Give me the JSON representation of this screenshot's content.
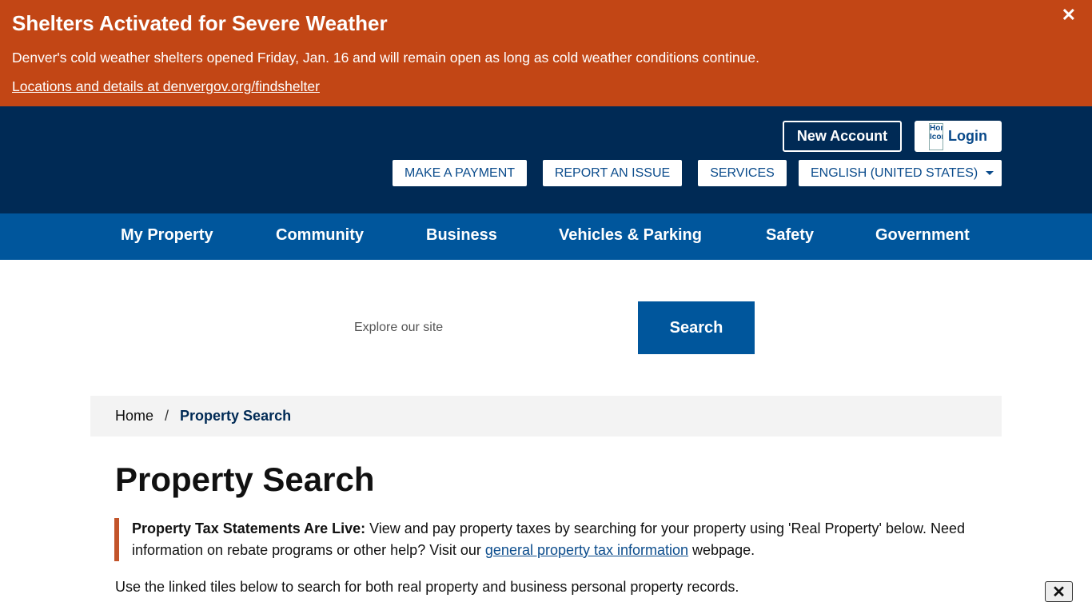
{
  "alert": {
    "title": "Shelters Activated for Severe Weather",
    "text": "Denver's cold weather shelters opened Friday, Jan. 16 and will remain open as long as cold weather conditions continue.",
    "link": "Locations and details at denvergov.org/findshelter",
    "close": "✕"
  },
  "header": {
    "new_account": "New Account",
    "login_icon_alt": "Home Icon",
    "login": "Login",
    "utility": {
      "payment": "MAKE A PAYMENT",
      "report": "REPORT AN ISSUE",
      "services": "SERVICES",
      "language": "ENGLISH (UNITED STATES)"
    }
  },
  "nav": {
    "items": [
      "My Property",
      "Community",
      "Business",
      "Vehicles & Parking",
      "Safety",
      "Government"
    ]
  },
  "search": {
    "placeholder": "Explore our site",
    "value": "",
    "button": "Search"
  },
  "breadcrumb": {
    "home": "Home",
    "separator": "/",
    "current": "Property Search"
  },
  "content": {
    "title": "Property Search",
    "notice_bold": "Property Tax Statements Are Live:",
    "notice_text": " View and pay property taxes by searching for your property using 'Real Property' below. Need information on rebate programs or other help? Visit our ",
    "notice_link": "general property tax information",
    "notice_end": " webpage.",
    "intro": "Use the linked tiles below to search for both real property and business personal property records."
  },
  "corner_close": "✕",
  "colors": {
    "alert_bg": "#c24615",
    "header_bg": "#002a55",
    "nav_bg": "#00569c",
    "accent_border": "#c2542a"
  }
}
